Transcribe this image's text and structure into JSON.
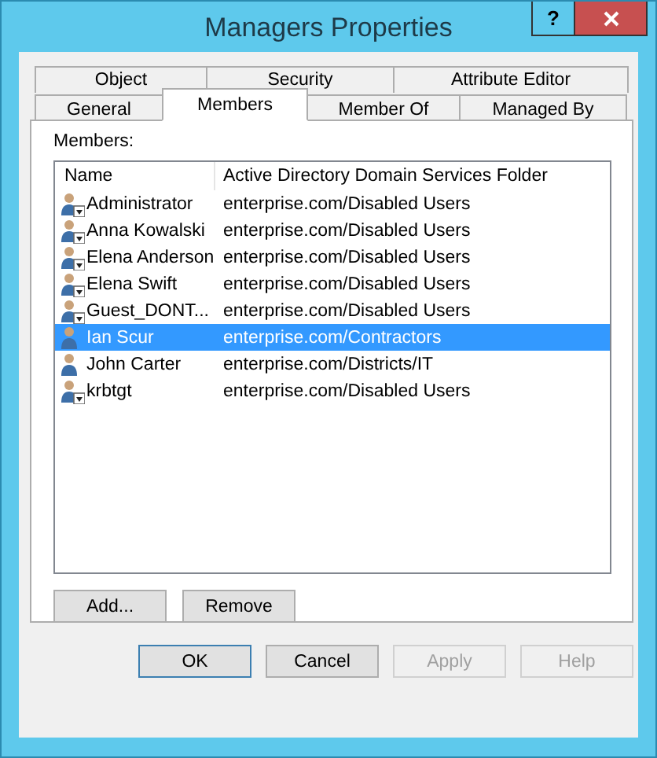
{
  "window": {
    "title": "Managers Properties",
    "help_button": "?"
  },
  "tab_rows": [
    [
      {
        "label": "Object",
        "selected": false
      },
      {
        "label": "Security",
        "selected": false
      },
      {
        "label": "Attribute Editor",
        "selected": false
      }
    ],
    [
      {
        "label": "General",
        "selected": false
      },
      {
        "label": "Members",
        "selected": true
      },
      {
        "label": "Member Of",
        "selected": false
      },
      {
        "label": "Managed By",
        "selected": false
      }
    ]
  ],
  "members_label": "Members:",
  "list": {
    "columns": [
      "Name",
      "Active Directory Domain Services Folder"
    ],
    "rows": [
      {
        "name": "Administrator",
        "folder": "enterprise.com/Disabled Users",
        "disabled": true,
        "selected": false
      },
      {
        "name": "Anna Kowalski",
        "folder": "enterprise.com/Disabled Users",
        "disabled": true,
        "selected": false
      },
      {
        "name": "Elena Anderson",
        "folder": "enterprise.com/Disabled Users",
        "disabled": true,
        "selected": false
      },
      {
        "name": "Elena Swift",
        "folder": "enterprise.com/Disabled Users",
        "disabled": true,
        "selected": false
      },
      {
        "name": "Guest_DONT...",
        "folder": "enterprise.com/Disabled Users",
        "disabled": true,
        "selected": false
      },
      {
        "name": "Ian Scur",
        "folder": "enterprise.com/Contractors",
        "disabled": false,
        "selected": true
      },
      {
        "name": "John Carter",
        "folder": "enterprise.com/Districts/IT",
        "disabled": false,
        "selected": false
      },
      {
        "name": "krbtgt",
        "folder": "enterprise.com/Disabled Users",
        "disabled": true,
        "selected": false
      }
    ]
  },
  "list_buttons": [
    "Add...",
    "Remove"
  ],
  "dialog_buttons": [
    {
      "label": "OK",
      "disabled": false,
      "default": true
    },
    {
      "label": "Cancel",
      "disabled": false,
      "default": false
    },
    {
      "label": "Apply",
      "disabled": true,
      "default": false
    },
    {
      "label": "Help",
      "disabled": true,
      "default": false
    }
  ]
}
